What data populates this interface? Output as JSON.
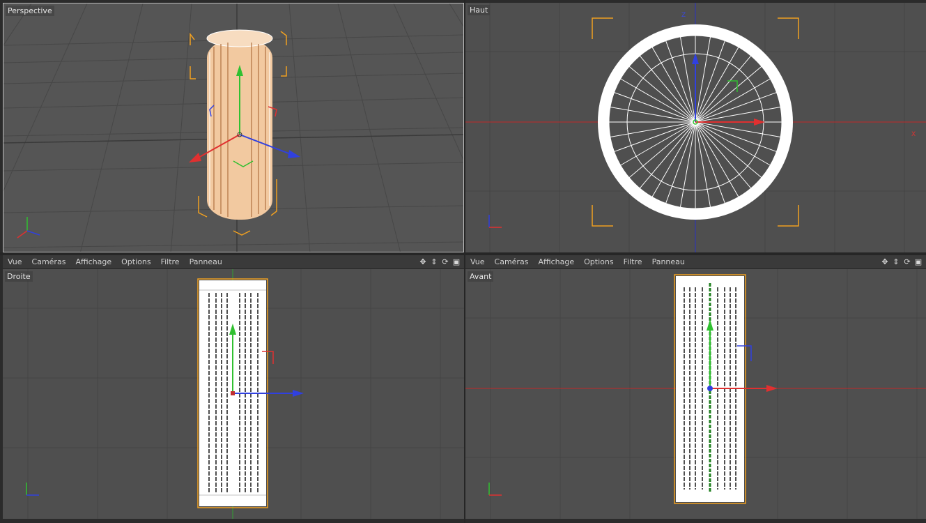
{
  "viewports": {
    "perspective": {
      "label": "Perspective"
    },
    "top": {
      "label": "Haut",
      "axis_z": "Z",
      "axis_x": "X"
    },
    "right": {
      "label": "Droite"
    },
    "front": {
      "label": "Avant"
    }
  },
  "menu": {
    "items": [
      "Vue",
      "Caméras",
      "Affichage",
      "Options",
      "Filtre",
      "Panneau"
    ]
  },
  "tools": {
    "move_icon": "move-icon",
    "zoom_icon": "zoom-icon",
    "rotate_icon": "rotate-icon",
    "maximize_icon": "maximize-icon"
  },
  "axis_indicator": {
    "y": "Y",
    "z": "Z",
    "x": "X"
  },
  "colors": {
    "viewport_bg": "#4f4f4f",
    "grid": "#444444",
    "axis_x": "#e03030",
    "axis_y": "#30c030",
    "axis_z": "#3040e0",
    "selection": "#f0a020",
    "wireframe": "#ffffff",
    "object_fill": "#f2c9a0"
  }
}
